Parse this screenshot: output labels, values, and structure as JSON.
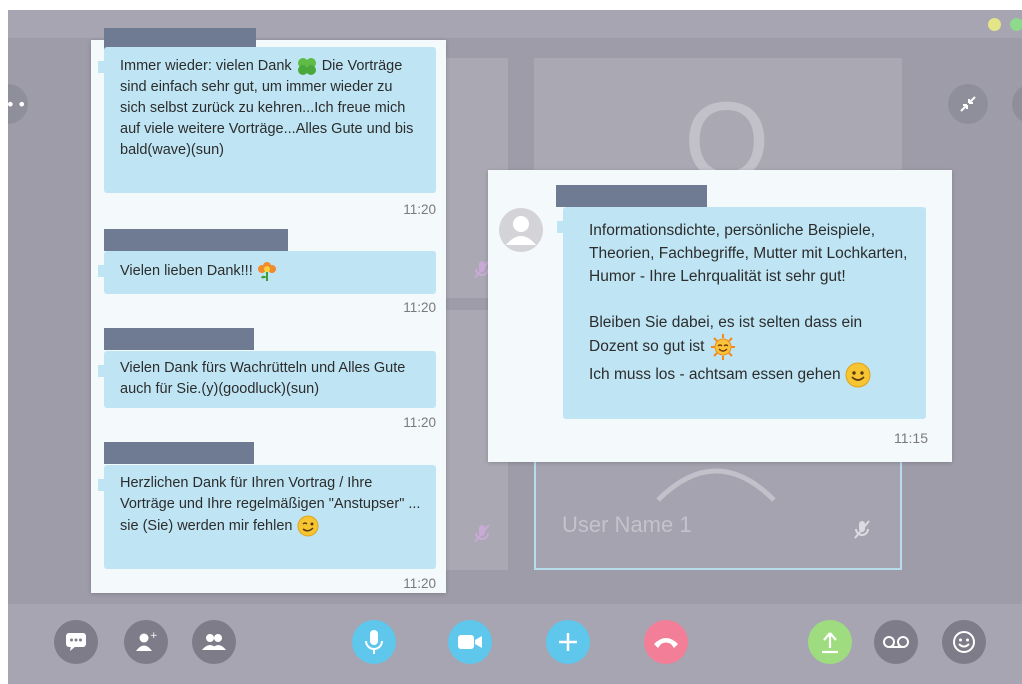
{
  "call": {
    "tile_user_name": "User Name 1",
    "tile_avatar_glyph": "O"
  },
  "chat_left": {
    "messages": [
      {
        "text_before_emoji": "Immer wieder: vielen Dank ",
        "emoji": "clover-emoji",
        "text_after_emoji": " Die Vorträge sind einfach sehr gut, um immer wieder zu sich selbst zurück zu kehren...Ich freue mich auf viele weitere Vorträge...Alles Gute und bis bald(wave)(sun)",
        "time": "11:20"
      },
      {
        "text_before_emoji": "Vielen lieben Dank!!! ",
        "emoji": "flower-emoji",
        "text_after_emoji": "",
        "time": "11:20"
      },
      {
        "text_before_emoji": "Vielen Dank fürs Wachrütteln und Alles Gute auch für Sie.(y)(goodluck)(sun)",
        "emoji": "",
        "text_after_emoji": "",
        "time": "11:20"
      },
      {
        "text_before_emoji": "Herzlichen Dank für Ihren Vortrag / Ihre Vorträge und Ihre regelmäßigen \"Anstupser\" ... sie (Sie) werden mir fehlen ",
        "emoji": "wink-emoji",
        "text_after_emoji": "",
        "time": "11:20"
      }
    ]
  },
  "chat_right": {
    "paragraph_1": "Informationsdichte, persönliche Beispiele, Theorien, Fachbegriffe, Mutter mit Lochkarten, Humor - Ihre Lehrqualität ist sehr gut!",
    "paragraph_2_before_emoji": "Bleiben Sie dabei, es ist selten dass ein Dozent so gut ist ",
    "paragraph_2_emoji": "sun-emoji",
    "paragraph_3_before_emoji": "Ich muss los - achtsam essen gehen ",
    "paragraph_3_emoji": "smile-emoji",
    "time": "11:15",
    "avatar_icon": "avatar-placeholder-icon"
  },
  "toolbar": {
    "buttons": [
      "chat-icon",
      "add-person-icon",
      "contacts-icon",
      "microphone-icon",
      "video-icon",
      "plus-icon",
      "hang-up-icon",
      "share-upload-icon",
      "voicemail-icon",
      "emoticon-icon"
    ]
  },
  "colors": {
    "bubble": "#bfe5f4",
    "name_bar": "#6f7b93",
    "call_bg": "#9d9ca8",
    "toolbar_blue": "#5fc6ec",
    "hangup_pink": "#f27f97",
    "share_green": "#9fdc7f"
  }
}
